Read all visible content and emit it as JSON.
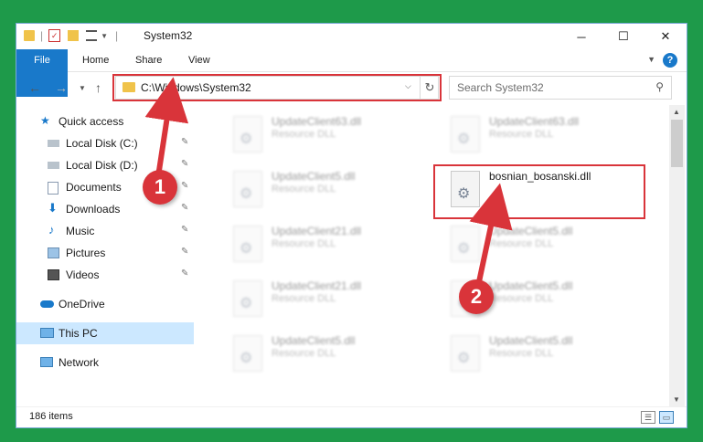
{
  "window": {
    "title": "System32",
    "controls": {
      "minimize": "─",
      "maximize": "☐",
      "close": "✕"
    }
  },
  "ribbon": {
    "tabs": [
      "File",
      "Home",
      "Share",
      "View"
    ],
    "help": "?"
  },
  "address": {
    "path": "C:\\Windows\\System32",
    "search_placeholder": "Search System32"
  },
  "nav": {
    "items": [
      {
        "label": "Quick access",
        "icon": "star-icon",
        "pinned": false
      },
      {
        "label": "Local Disk (C:)",
        "icon": "drive-icon",
        "pinned": true
      },
      {
        "label": "Local Disk (D:)",
        "icon": "drive-icon",
        "pinned": true
      },
      {
        "label": "Documents",
        "icon": "documents-icon",
        "pinned": true
      },
      {
        "label": "Downloads",
        "icon": "download-icon",
        "pinned": true
      },
      {
        "label": "Music",
        "icon": "music-icon",
        "pinned": true
      },
      {
        "label": "Pictures",
        "icon": "pictures-icon",
        "pinned": true
      },
      {
        "label": "Videos",
        "icon": "videos-icon",
        "pinned": true
      },
      {
        "label": "OneDrive",
        "icon": "cloud-icon",
        "pinned": false
      },
      {
        "label": "This PC",
        "icon": "computer-icon",
        "pinned": false
      },
      {
        "label": "Network",
        "icon": "network-icon",
        "pinned": false
      }
    ]
  },
  "files": [
    {
      "name": "UpdateClient63.dll",
      "type": "Resource DLL"
    },
    {
      "name": "UpdateClient63.dll",
      "type": "Resource DLL"
    },
    {
      "name": "UpdateClient5.dll",
      "type": "Resource DLL"
    },
    {
      "name": "bosnian_bosanski.dll",
      "type": ""
    },
    {
      "name": "UpdateClient21.dll",
      "type": "Resource DLL"
    },
    {
      "name": "UpdateClient5.dll",
      "type": "Resource DLL"
    },
    {
      "name": "UpdateClient21.dll",
      "type": "Resource DLL"
    },
    {
      "name": "UpdateClient5.dll",
      "type": "Resource DLL"
    },
    {
      "name": "UpdateClient5.dll",
      "type": "Resource DLL"
    },
    {
      "name": "UpdateClient5.dll",
      "type": "Resource DLL"
    }
  ],
  "status": {
    "count": "186 items"
  },
  "annotations": {
    "step1": "1",
    "step2": "2"
  },
  "colors": {
    "accent": "#1979ca",
    "highlight": "#d9343a",
    "background": "#1e9a4a",
    "selected": "#cce8ff"
  }
}
